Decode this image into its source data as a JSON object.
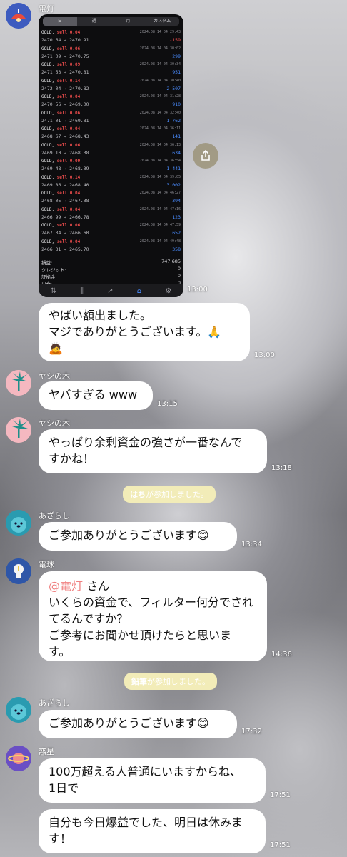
{
  "messages": {
    "m1": {
      "sender": "電灯",
      "time": "13:00"
    },
    "m2": {
      "lines": [
        "やばい額出ました。",
        "マジでありがとうございます。🙏",
        "🙇"
      ],
      "time": "13:00"
    },
    "m3": {
      "sender": "ヤシの木",
      "text": "ヤバすぎる www",
      "time": "13:15"
    },
    "m4": {
      "sender": "ヤシの木",
      "lines": [
        "やっぱり余剰資金の強さが一番なんで",
        "すかね！"
      ],
      "time": "13:18"
    },
    "sys1": {
      "name": "はち",
      "suffix": "が参加しました。"
    },
    "m5": {
      "sender": "あざらし",
      "text": "ご参加ありがとうございます😊",
      "time": "13:34"
    },
    "m6": {
      "sender": "電球",
      "mention": "@電灯",
      "mention_suffix": " さん",
      "lines": [
        "いくらの資金で、フィルター何分でされ",
        "てるんですか？",
        "ご参考にお聞かせ頂けたらと思いま",
        "す。"
      ],
      "time": "14:36"
    },
    "sys2": {
      "name": "鉛筆",
      "suffix": "が参加しました。"
    },
    "m7": {
      "sender": "あざらし",
      "text": "ご参加ありがとうございます😊",
      "time": "17:32"
    },
    "m8": {
      "sender": "惑星",
      "lines": [
        "100万超える人普通にいますからね、",
        "1日で"
      ],
      "time": "17:51"
    },
    "m9": {
      "lines": [
        "自分も今日爆益でした、明日は休みま",
        "す！"
      ],
      "time": "17:51"
    }
  },
  "screenshot": {
    "tabs": [
      "日",
      "週",
      "月",
      "カスタム"
    ],
    "trades": [
      {
        "sym": "GOLD,",
        "side": "sell 0.04",
        "prices": "2470.64 → 2470.91",
        "ts": "2024.08.14 04:29:43",
        "pl": "-159",
        "neg": true
      },
      {
        "sym": "GOLD,",
        "side": "sell 0.06",
        "prices": "2471.09 → 2470.75",
        "ts": "2024.08.14 04:30:02",
        "pl": "299",
        "neg": false
      },
      {
        "sym": "GOLD,",
        "side": "sell 0.09",
        "prices": "2471.53 → 2470.81",
        "ts": "2024.08.14 04:30:34",
        "pl": "951",
        "neg": false
      },
      {
        "sym": "GOLD,",
        "side": "sell 0.14",
        "prices": "2472.04 → 2470.82",
        "ts": "2024.08.14 04:30:40",
        "pl": "2 507",
        "neg": false
      },
      {
        "sym": "GOLD,",
        "side": "sell 0.04",
        "prices": "2470.56 → 2469.00",
        "ts": "2024.08.14 04:31:28",
        "pl": "910",
        "neg": false
      },
      {
        "sym": "GOLD,",
        "side": "sell 0.06",
        "prices": "2471.01 → 2469.81",
        "ts": "2024.08.14 04:32:40",
        "pl": "1 762",
        "neg": false
      },
      {
        "sym": "GOLD,",
        "side": "sell 0.04",
        "prices": "2468.67 → 2468.43",
        "ts": "2024.08.14 04:36:11",
        "pl": "141",
        "neg": false
      },
      {
        "sym": "GOLD,",
        "side": "sell 0.06",
        "prices": "2469.10 → 2468.38",
        "ts": "2024.08.14 04:36:13",
        "pl": "634",
        "neg": false
      },
      {
        "sym": "GOLD,",
        "side": "sell 0.09",
        "prices": "2469.48 → 2468.39",
        "ts": "2024.08.14 04:36:54",
        "pl": "1 441",
        "neg": false
      },
      {
        "sym": "GOLD,",
        "side": "sell 0.14",
        "prices": "2469.86 → 2468.40",
        "ts": "2024.08.14 04:39:05",
        "pl": "3 002",
        "neg": false
      },
      {
        "sym": "GOLD,",
        "side": "sell 0.04",
        "prices": "2468.05 → 2467.38",
        "ts": "2024.08.14 04:46:27",
        "pl": "394",
        "neg": false
      },
      {
        "sym": "GOLD,",
        "side": "sell 0.04",
        "prices": "2466.99 → 2466.78",
        "ts": "2024.08.14 04:47:16",
        "pl": "123",
        "neg": false
      },
      {
        "sym": "GOLD,",
        "side": "sell 0.06",
        "prices": "2467.34 → 2466.60",
        "ts": "2024.08.14 04:47:59",
        "pl": "652",
        "neg": false
      },
      {
        "sym": "GOLD,",
        "side": "sell 0.04",
        "prices": "2466.31 → 2465.70",
        "ts": "2024.08.14 04:49:48",
        "pl": "358",
        "neg": false
      }
    ],
    "summary": [
      {
        "label": "損益:",
        "value": "747 685"
      },
      {
        "label": "クレジット:",
        "value": "0"
      },
      {
        "label": "証拠金:",
        "value": "0"
      },
      {
        "label": "出金:",
        "value": "0"
      },
      {
        "label": "残高:",
        "value": "747 685"
      }
    ]
  },
  "colors": {
    "mention": "#f08080",
    "loss": "#e84b4b",
    "profit": "#4a8cff",
    "system": "#f2ecb8"
  }
}
